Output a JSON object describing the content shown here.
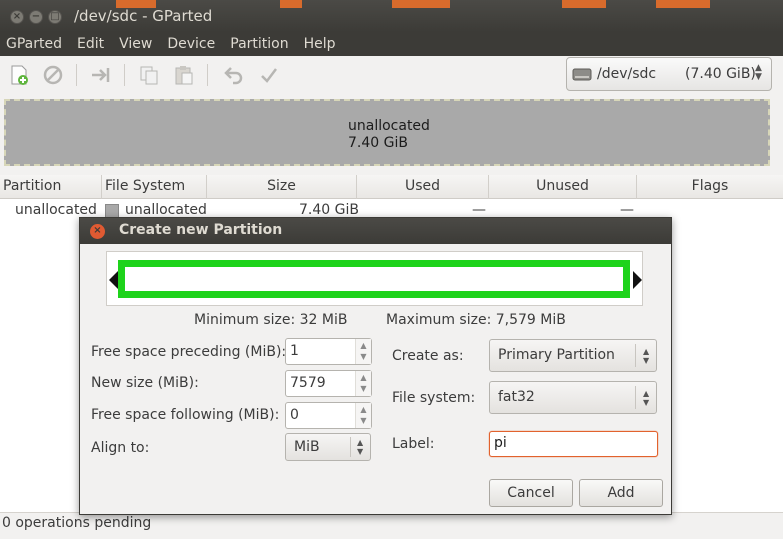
{
  "window": {
    "title": "/dev/sdc - GParted",
    "close_glyph": "×",
    "minimize_glyph": "−",
    "maximize_glyph": "□"
  },
  "menubar": {
    "items": [
      "GParted",
      "Edit",
      "View",
      "Device",
      "Partition",
      "Help"
    ]
  },
  "toolbar": {
    "icons": [
      "new-partition-icon",
      "delete-icon",
      "resize-move-icon",
      "copy-icon",
      "paste-icon",
      "undo-icon",
      "apply-icon"
    ],
    "device": {
      "name": "/dev/sdc",
      "size": "(7.40 GiB)"
    }
  },
  "partition_visual": {
    "label": "unallocated",
    "size": "7.40 GiB",
    "color": "#a9a9a9"
  },
  "table": {
    "headers": [
      "Partition",
      "File System",
      "Size",
      "Used",
      "Unused",
      "Flags"
    ],
    "rows": [
      {
        "partition": "unallocated",
        "filesystem": "unallocated",
        "size": "7.40 GiB",
        "used": "—",
        "unused": "—",
        "flags": ""
      }
    ]
  },
  "statusbar": {
    "text": "0 operations pending"
  },
  "dialog": {
    "title": "Create new Partition",
    "min_size": "Minimum size: 32 MiB",
    "max_size": "Maximum size: 7,579 MiB",
    "fields": {
      "free_preceding_label": "Free space preceding (MiB):",
      "free_preceding_value": "1",
      "new_size_label": "New size (MiB):",
      "new_size_value": "7579",
      "free_following_label": "Free space following (MiB):",
      "free_following_value": "0",
      "align_label": "Align to:",
      "align_value": "MiB",
      "create_as_label": "Create as:",
      "create_as_value": "Primary Partition",
      "filesystem_label": "File system:",
      "filesystem_value": "fat32",
      "label_label": "Label:",
      "label_value": "pi"
    },
    "buttons": {
      "cancel": "Cancel",
      "add": "Add"
    },
    "accent_color": "#1ed31b"
  }
}
